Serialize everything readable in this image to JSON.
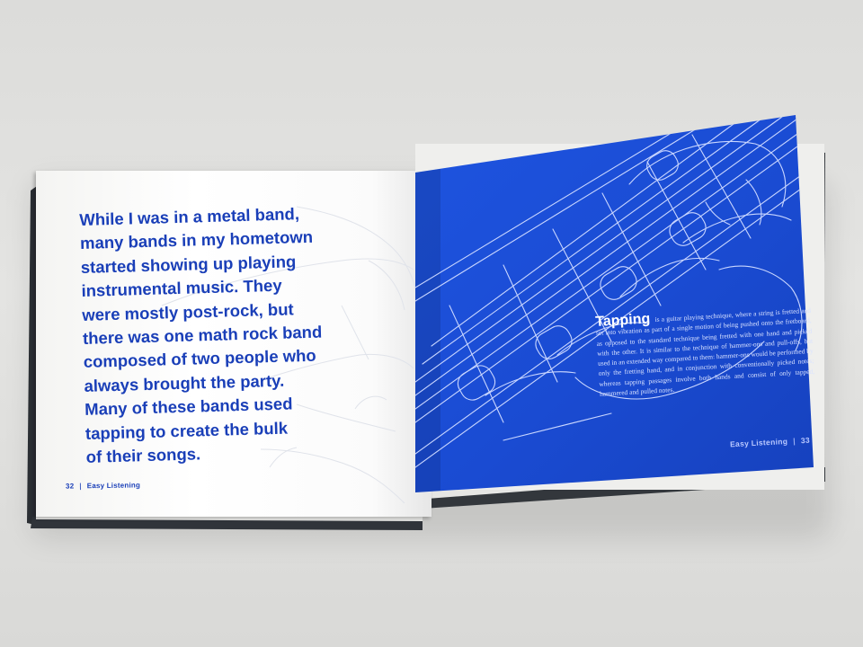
{
  "left_page": {
    "lines": [
      "While I was in a metal band,",
      "many bands in my hometown",
      "started showing up playing",
      "instrumental music. They",
      "were mostly post-rock, but",
      "there was one math rock band",
      "composed of two people who",
      "always brought the party.",
      "Many of these bands used",
      "tapping to create the bulk",
      "of their songs."
    ],
    "folio_number": "32",
    "folio_title": "Easy Listening"
  },
  "right_page": {
    "sidebar_title": "Tapping",
    "sidebar_body": "is a guitar playing technique, where a string is fretted and set into vibration as part of a single motion of being pushed onto the fretboard, as opposed to the standard technique being fretted with one hand and picked with the other. It is similar to the technique of hammer-ons and pull-offs, but used in an extended way compared to them: hammer-ons would be performed by only the fretting hand, and in conjunction with conventionally picked notes; whereas tapping passages involve both hands and consist of only tapped, hammered and pulled notes.",
    "folio_title": "Easy Listening",
    "folio_number": "33"
  },
  "colors": {
    "ink_blue": "#1a3fb8",
    "page_blue": "#1c4fd8",
    "line_art": "#c9d6ff",
    "paper": "#ffffff",
    "table": "#dededc",
    "cover": "#2a2e33"
  }
}
